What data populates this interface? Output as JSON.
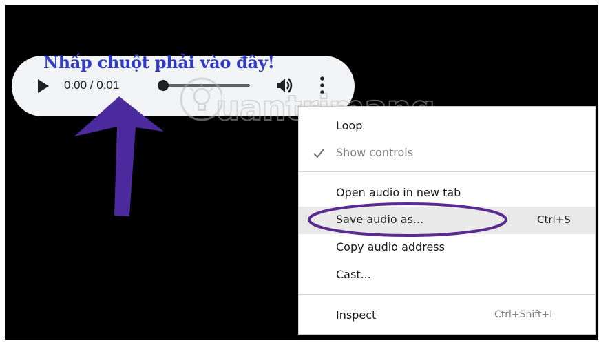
{
  "annotation": {
    "text": "Nhấp chuột phải vào đây!"
  },
  "player": {
    "time": "0:00 / 0:01",
    "progress": 0.0
  },
  "watermark": {
    "text": "uantrimang"
  },
  "context_menu": {
    "items": [
      {
        "label": "Loop"
      },
      {
        "label": "Show controls",
        "checked": true,
        "disabled": true
      },
      {
        "label": "Open audio in new tab"
      },
      {
        "label": "Save audio as...",
        "shortcut": "Ctrl+S",
        "highlighted": true
      },
      {
        "label": "Copy audio address"
      },
      {
        "label": "Cast..."
      },
      {
        "label": "Inspect",
        "shortcut": "Ctrl+Shift+I"
      }
    ]
  },
  "colors": {
    "annotation_text": "#2f3bc6",
    "arrow": "#4b2a9e",
    "ellipse": "#5a2b8f",
    "player_bg": "#f1f3f4",
    "menu_highlight": "#e9e9e9"
  },
  "icons": {
    "play": "play-icon",
    "volume": "volume-icon",
    "more": "more-vertical-icon",
    "check": "check-icon",
    "arrow": "arrow-up-annotation"
  }
}
